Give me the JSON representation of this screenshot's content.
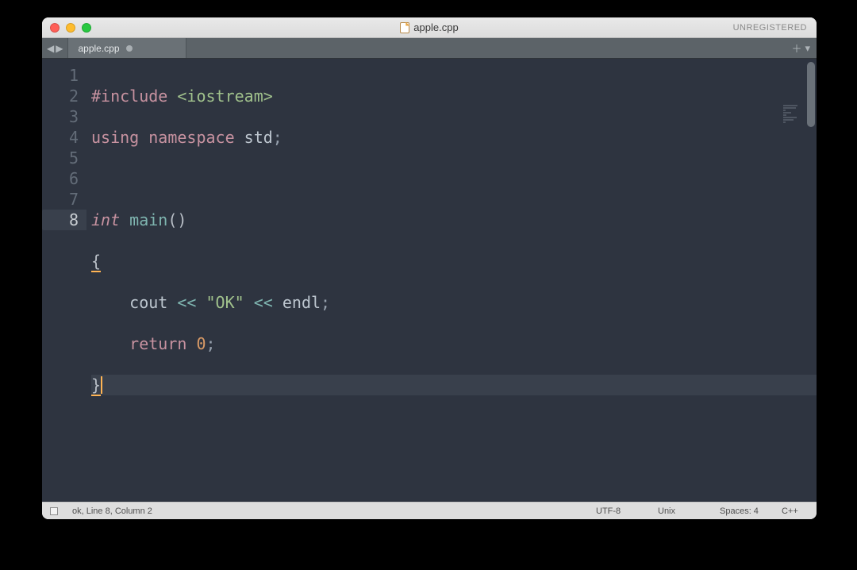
{
  "window": {
    "title": "apple.cpp",
    "unregistered": "UNREGISTERED"
  },
  "tabs": {
    "nav_back": "◀",
    "nav_fwd": "▶",
    "active": {
      "label": "apple.cpp",
      "dirty": true
    },
    "add": "＋",
    "menu": "▾"
  },
  "gutter": {
    "lines": [
      "1",
      "2",
      "3",
      "4",
      "5",
      "6",
      "7",
      "8"
    ],
    "current": 8
  },
  "code": {
    "l1": {
      "a": "#include ",
      "b": "<iostream>"
    },
    "l2": {
      "a": "using",
      "b": " namespace ",
      "c": "std",
      "d": ";"
    },
    "l3": "",
    "l4": {
      "a": "int",
      "b": " ",
      "c": "main",
      "d": "(",
      "e": ")"
    },
    "l5": "{",
    "l6": {
      "indent": "    ",
      "a": "cout",
      "b": " << ",
      "c": "\"OK\"",
      "d": " << ",
      "e": "endl",
      "f": ";"
    },
    "l7": {
      "indent": "    ",
      "a": "return",
      "b": " ",
      "c": "0",
      "d": ";"
    },
    "l8": "}"
  },
  "status": {
    "left": "ok, Line 8, Column 2",
    "encoding": "UTF-8",
    "lineending": "Unix",
    "indent": "Spaces: 4",
    "syntax": "C++"
  }
}
